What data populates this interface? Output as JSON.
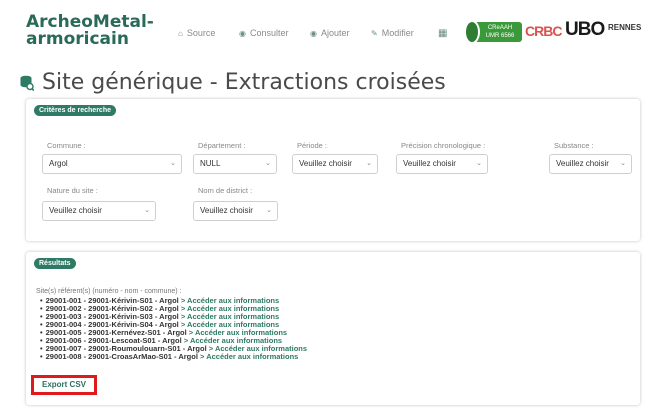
{
  "top_clip_text": "",
  "brand": {
    "line1": "ArcheoMetal-",
    "line2": "armoricain"
  },
  "nav": {
    "source": "Source",
    "consulter": "Consulter",
    "ajouter": "Ajouter",
    "modifier": "Modifier"
  },
  "logos": {
    "caeaah": "CReAAH\nUMR 6566",
    "crbc": "CRBC",
    "ubo": "UBO",
    "ubo_sub": "",
    "rennes": "RENNES"
  },
  "page": {
    "title": "Site générique - Extractions croisées"
  },
  "criteria": {
    "badge": "Critères de recherche",
    "commune": {
      "label": "Commune :",
      "value": "Argol"
    },
    "departement": {
      "label": "Département :",
      "value": "NULL"
    },
    "periode": {
      "label": "Période :",
      "value": "Veuillez choisir"
    },
    "precision": {
      "label": "Précision chronologique :",
      "value": "Veuillez choisir"
    },
    "substance": {
      "label": "Substance :",
      "value": "Veuillez choisir"
    },
    "nature": {
      "label": "Nature du site :",
      "value": "Veuillez choisir"
    },
    "district": {
      "label": "Nom de district :",
      "value": "Veuillez choisir"
    }
  },
  "results": {
    "badge": "Résultats",
    "intro": "Site(s) référent(s) (numéro - nom - commune) :",
    "link_text": "> Accéder aux informations",
    "items": [
      "29001-001 - 29001-Kérivin-S01 - Argol",
      "29001-002 - 29001-Kérivin-S02 - Argol",
      "29001-003 - 29001-Kérivin-S03 - Argol",
      "29001-004 - 29001-Kérivin-S04 - Argol",
      "29001-005 - 29001-Kernévez-S01 - Argol",
      "29001-006 - 29001-Lescoat-S01 - Argol",
      "29001-007 - 29001-Roumoulouarn-S01 - Argol",
      "29001-008 - 29001-CroasArMao-S01 - Argol"
    ],
    "export": "Export CSV"
  },
  "colors": {
    "accent": "#2e7a64",
    "highlight_box": "#e0191c"
  }
}
